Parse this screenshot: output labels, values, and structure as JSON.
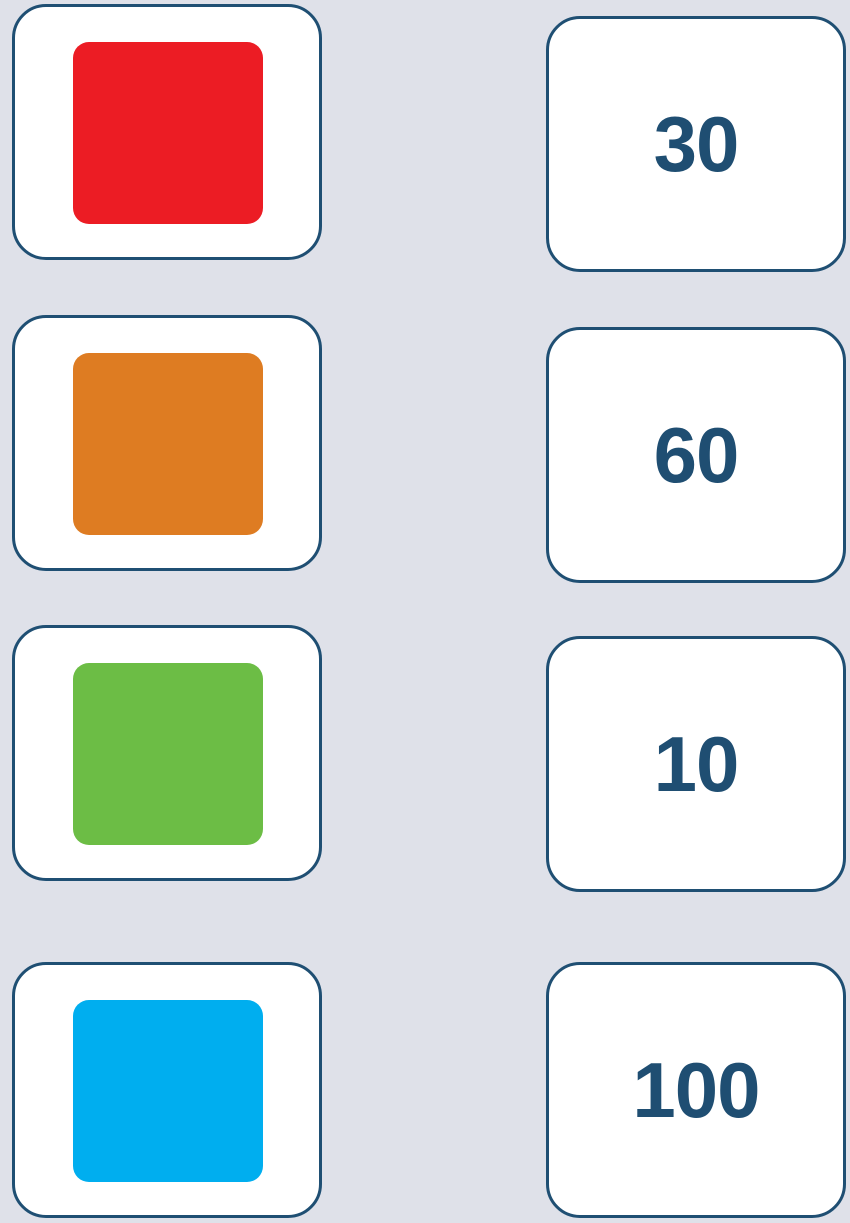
{
  "rows": [
    {
      "color": "#ec1c24",
      "value": "30"
    },
    {
      "color": "#de7c22",
      "value": "60"
    },
    {
      "color": "#6cbd45",
      "value": "10"
    },
    {
      "color": "#00aeef",
      "value": "100"
    }
  ]
}
